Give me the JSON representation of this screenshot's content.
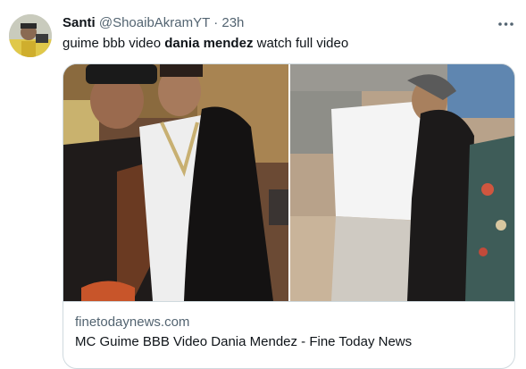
{
  "tweet": {
    "author": {
      "name": "Santi",
      "handle": "@ShoaibAkramYT",
      "separator": "·",
      "time": "23h"
    },
    "text_prefix": "guime bbb video ",
    "text_bold": "dania mendez",
    "text_suffix": " watch full video",
    "more_icon": "more-horizontal-icon"
  },
  "card": {
    "domain": "finetodaynews.com",
    "title": "MC Guime BBB Video Dania Mendez - Fine Today News"
  },
  "colors": {
    "text_primary": "#0f1419",
    "text_secondary": "#536471",
    "border": "#cfd9de"
  }
}
